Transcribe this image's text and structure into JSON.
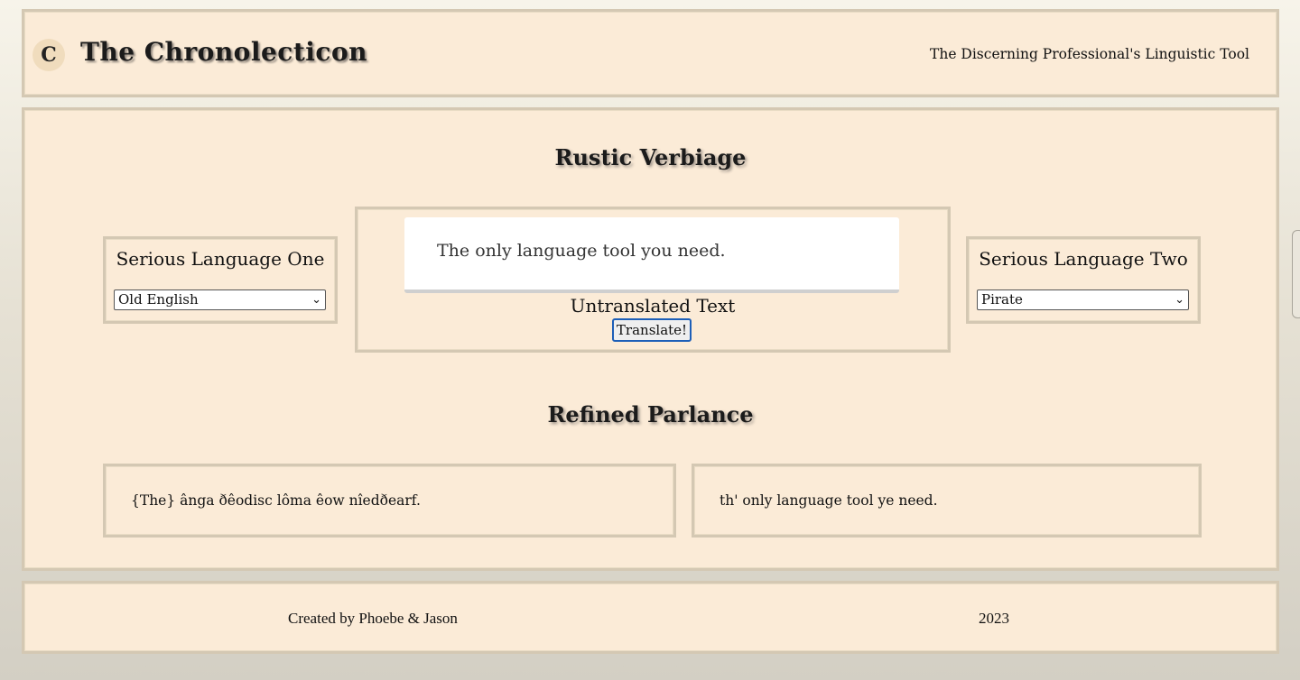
{
  "header": {
    "logo_glyph": "C",
    "title": "The Chronolecticon",
    "tagline": "The Discerning Professional's Linguistic Tool"
  },
  "main": {
    "rustic_heading": "Rustic Verbiage",
    "language_one": {
      "title": "Serious Language One",
      "selected": "Old English"
    },
    "language_two": {
      "title": "Serious Language Two",
      "selected": "Pirate"
    },
    "input": {
      "value": "The only language tool you need.",
      "label": "Untranslated Text",
      "button_label": "Translate!"
    },
    "refined_heading": "Refined Parlance",
    "output_one": "{The} ânga ðêodisc lôma êow nîedðearf.",
    "output_two": "th' only language tool ye need."
  },
  "footer": {
    "credits": "Created by Phoebe & Jason",
    "year": "2023"
  },
  "icons": {
    "logo": "gothic-c-logo-icon",
    "select_caret": "chevron-down-icon"
  },
  "colors": {
    "panel_bg": "#fbebd7",
    "panel_border": "#d4c8b3",
    "button_border": "#1d5fb8"
  }
}
